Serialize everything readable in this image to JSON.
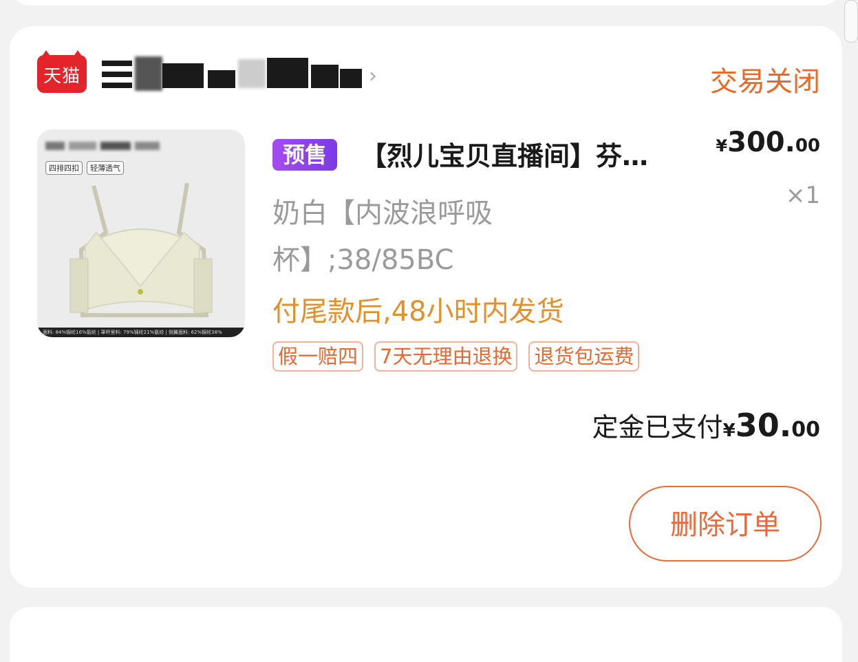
{
  "shop": {
    "logo_text": "天猫",
    "status": "交易关闭"
  },
  "product": {
    "presale_badge": "预售",
    "title": "【烈儿宝贝直播间】芬…",
    "price_currency": "¥",
    "price_integer": "300.",
    "price_decimal": "00",
    "quantity": "×1",
    "spec": "奶白【内波浪呼吸杯】;38/85BC",
    "shipping_note": "付尾款后,48小时内发货",
    "image_tags": [
      "四排四扣",
      "轻薄透气"
    ],
    "image_strip": "面料: 84%锦纶16%氨纶 | 罩杯里料: 79%锦纶21%氨纶 | 侧翼面料: 62%锦纶38%"
  },
  "service_tags": [
    "假一赔四",
    "7天无理由退换",
    "退货包运费"
  ],
  "deposit": {
    "label": "定金已支付",
    "currency": "¥",
    "integer": "30.",
    "decimal": "00"
  },
  "actions": {
    "delete_label": "删除订单"
  },
  "colors": {
    "status_orange": "#e8692a",
    "presale_purple": "#8e44ec",
    "shipping_gold": "#e0912e",
    "tmall_red": "#e3242b"
  }
}
